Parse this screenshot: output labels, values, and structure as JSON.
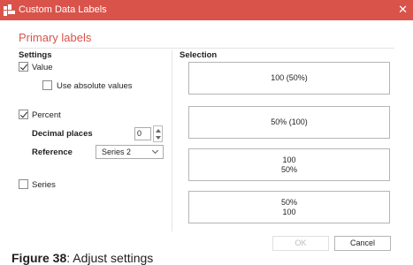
{
  "window": {
    "title": "Custom Data Labels",
    "close_glyph": "✕",
    "icon": "app-grid-icon"
  },
  "dialog": {
    "heading": "Primary labels"
  },
  "settings": {
    "title": "Settings",
    "value": {
      "label": "Value",
      "checked": true
    },
    "absolute": {
      "label": "Use absolute values",
      "checked": false
    },
    "percent": {
      "label": "Percent",
      "checked": true
    },
    "decimal": {
      "label": "Decimal places",
      "value": "0"
    },
    "reference": {
      "label": "Reference",
      "selected": "Series 2"
    },
    "series": {
      "label": "Series",
      "checked": false
    }
  },
  "selection": {
    "title": "Selection",
    "options": [
      "100 (50%)",
      "50% (100)",
      "100\n50%",
      "50%\n100"
    ]
  },
  "buttons": {
    "ok": "OK",
    "cancel": "Cancel"
  },
  "caption": {
    "label": "Figure 38",
    "text": ": Adjust settings"
  },
  "colors": {
    "accent": "#d9534a",
    "border": "#b5b5b5"
  }
}
